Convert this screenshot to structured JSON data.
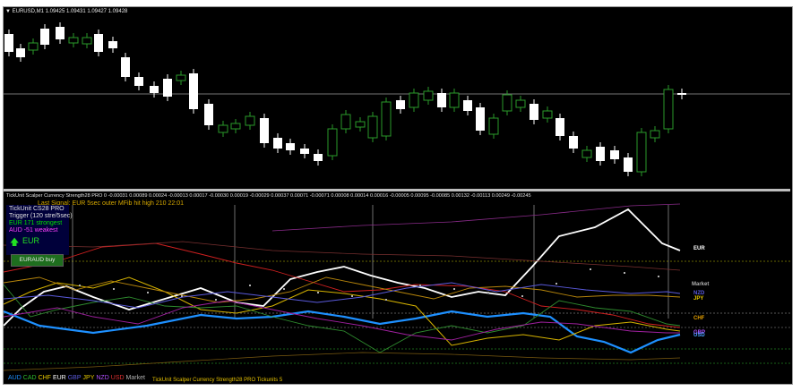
{
  "chart": {
    "title": "▼ EURUSD,M1  1.09425 1.09431 1.09427 1.09428",
    "colors": {
      "background": "#000000",
      "bull": "#ffffff",
      "bear": "#2a9a2a",
      "grid": "#6a6a6a",
      "hline": "#9a9a9a"
    }
  },
  "indicator": {
    "title": "TickUnit Scalper Currency Strength28 PRO 0  -0.00031  0.00089  0.00024  -0.00013  0.00017  -0.00030  0.00019  -0.00029  0.00037  0.00071  -0.00071  0.00008  0.00014  0.00016  -0.00005  0.00095  -0.00085  0.00132  -0.00113  0.00249  -0.00245",
    "last_signal": "Last Signal:  EUR 5sec outer MFib hit high 210 22:01",
    "info": {
      "name": "TickUnit CS28 PRO",
      "trigger": "Trigger (120 stre/5sec)",
      "strongest": "EUR 171 strongest",
      "weakest": "AUD -51 weakest",
      "arrow": "🡅",
      "currency": "EUR",
      "trade_button": "EURAUD buy"
    },
    "right_labels": {
      "eur": "EUR",
      "market": "Market",
      "nzd": "NZD",
      "jpy": "JPY",
      "chf": "CHF",
      "gbp": "GBP",
      "usd": "USD"
    },
    "legend": {
      "aud": "AUD",
      "cad": "CAD",
      "chf": "CHF",
      "eur": "EUR",
      "gbp": "GBP",
      "jpy": "JPY",
      "nzd": "NZD",
      "usd": "USD",
      "market": "Market"
    },
    "footer": "TickUnit Scalper Currency Strength28 PRO  Tickunits 5",
    "colors": {
      "EUR": "#ffffff",
      "AUD": "#1e90ff",
      "CAD": "#2e8b2e",
      "CHF": "#d7b400",
      "GBP": "#5a5adc",
      "JPY": "#b8860b",
      "NZD": "#a020a0",
      "USD": "#d02020",
      "Market": "#b0b0b0"
    }
  }
}
